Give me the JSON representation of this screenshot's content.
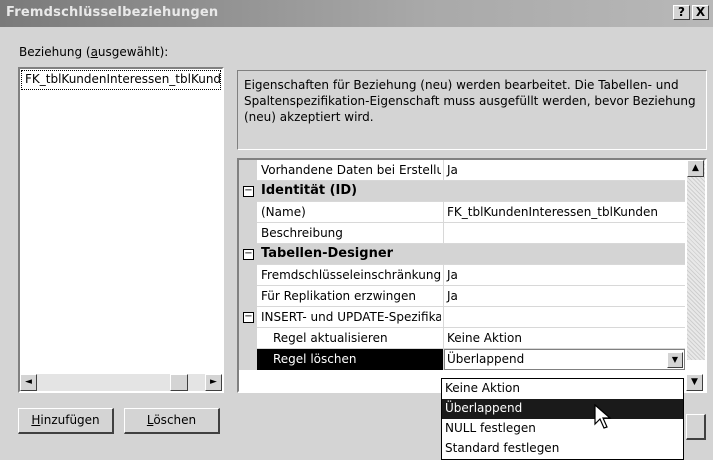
{
  "window": {
    "title": "Fremdschlüsselbeziehungen",
    "help_glyph": "?",
    "close_glyph": "X"
  },
  "left_panel": {
    "label": "Beziehung (ausgewählt):",
    "items": [
      {
        "label": "FK_tblKundenInteressen_tblKunden"
      }
    ]
  },
  "buttons": {
    "add": "Hinzufügen",
    "delete": "Löschen"
  },
  "description": "Eigenschaften für Beziehung (neu) werden bearbeitet.  Die Tabellen- und Spaltenspezifikation-Eigenschaft muss ausgefüllt werden, bevor Beziehung (neu) akzeptiert wird.",
  "properties": [
    {
      "type": "prop",
      "name": "Vorhandene Daten bei Erstellung prüfen",
      "value": "Ja"
    },
    {
      "type": "cat",
      "name": "Identität (ID)",
      "expander": "⊟"
    },
    {
      "type": "prop",
      "name": "(Name)",
      "value": "FK_tblKundenInteressen_tblKunden"
    },
    {
      "type": "prop",
      "name": "Beschreibung",
      "value": ""
    },
    {
      "type": "cat",
      "name": "Tabellen-Designer",
      "expander": "⊟"
    },
    {
      "type": "prop",
      "name": "Fremdschlüsseleinschränkung erzwingen",
      "value": "Ja"
    },
    {
      "type": "prop",
      "name": "Für Replikation erzwingen",
      "value": "Ja"
    },
    {
      "type": "group",
      "name": "INSERT- und UPDATE-Spezifikation",
      "value": "",
      "expander": "⊟"
    },
    {
      "type": "sub",
      "name": "Regel aktualisieren",
      "value": "Keine Aktion"
    },
    {
      "type": "sub-selected",
      "name": "Regel löschen",
      "value": "Überlappend"
    }
  ],
  "dropdown": {
    "options": [
      "Keine Aktion",
      "Überlappend",
      "NULL festlegen",
      "Standard festlegen"
    ],
    "highlighted": "Überlappend"
  },
  "icons": {
    "scroll_left": "◄",
    "scroll_right": "►",
    "scroll_up": "▲",
    "scroll_down": "▼",
    "dropdown_arrow": "▼"
  }
}
